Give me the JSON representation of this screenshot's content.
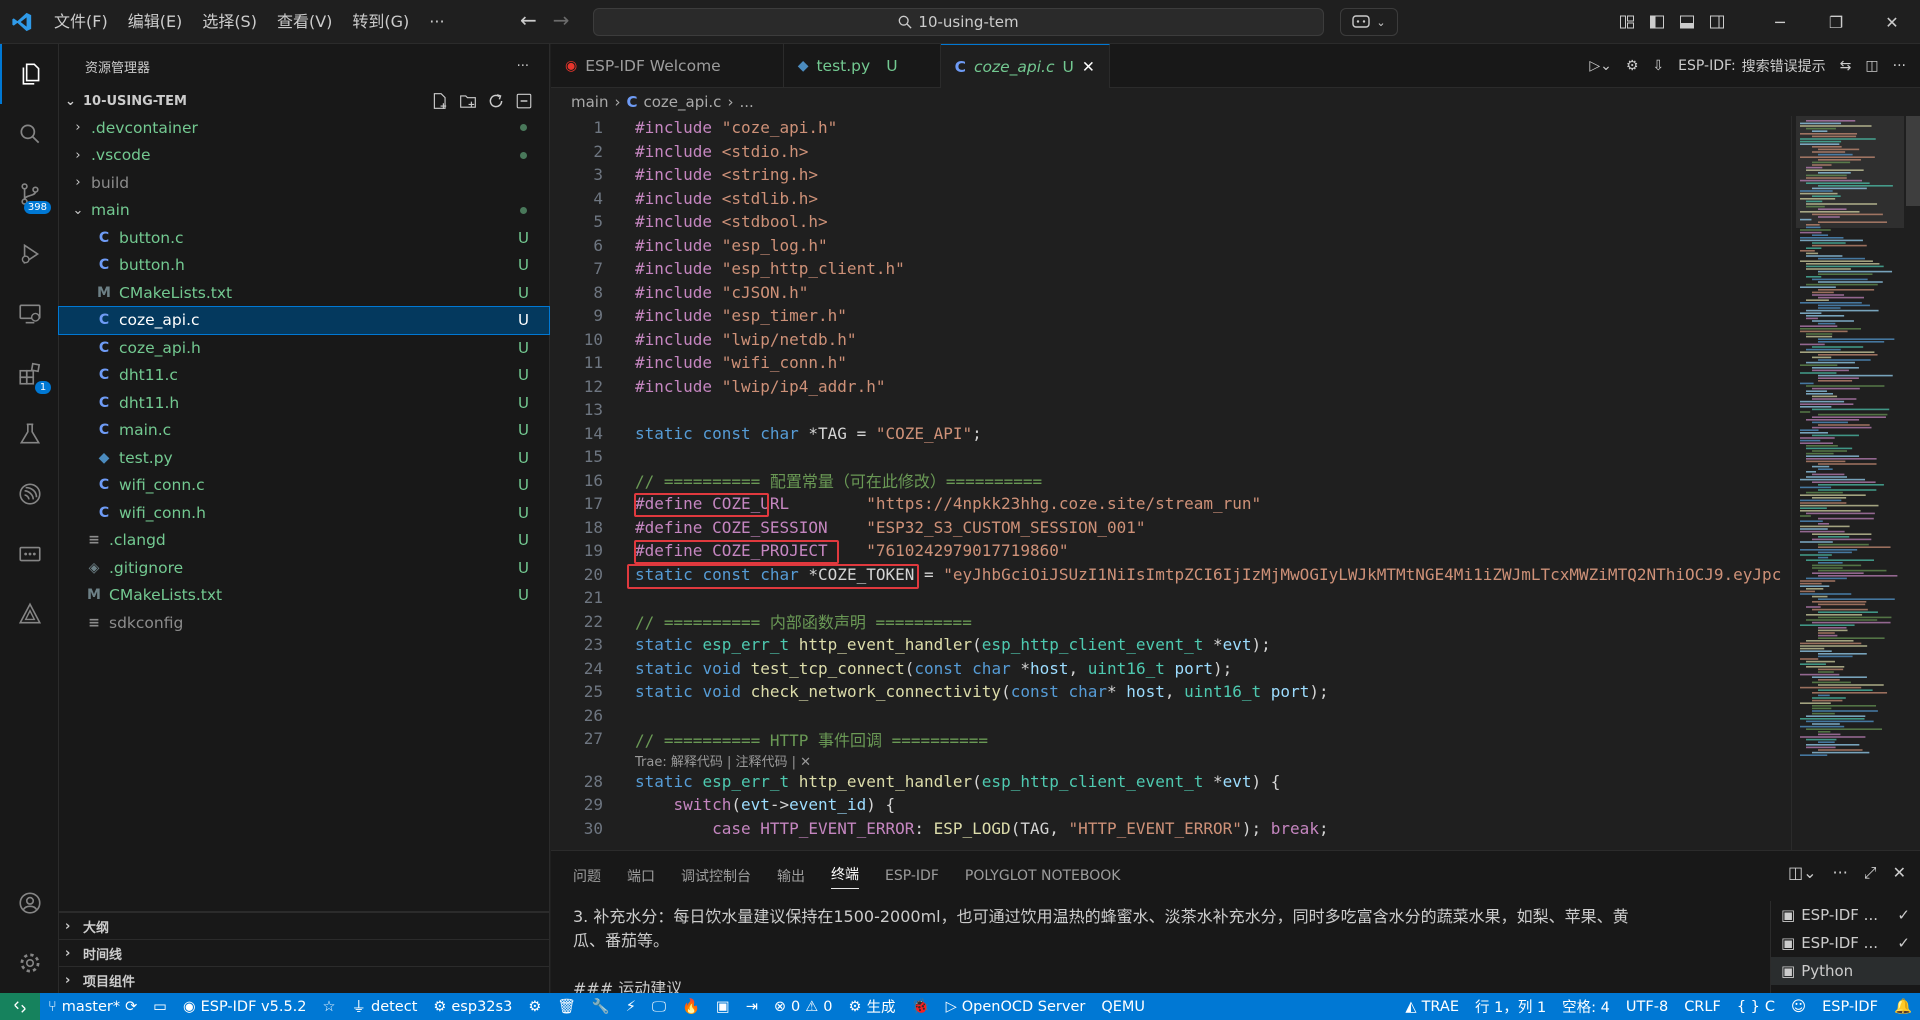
{
  "menu": [
    "文件(F)",
    "编辑(E)",
    "选择(S)",
    "查看(V)",
    "转到(G)",
    "···"
  ],
  "search": {
    "text": "10-using-tem"
  },
  "activity": {
    "scm_badge": "398",
    "ext_badge": "1"
  },
  "sidebar": {
    "title": "资源管理器",
    "more": "···",
    "root": "10-USING-TEM",
    "items": [
      {
        "name": ".devcontainer",
        "type": "folder-closed",
        "depth": 1,
        "status": "dot",
        "style": "git"
      },
      {
        "name": ".vscode",
        "type": "folder-closed",
        "depth": 1,
        "status": "dot",
        "style": "git"
      },
      {
        "name": "build",
        "type": "folder-closed",
        "depth": 1,
        "status": "",
        "style": "muted"
      },
      {
        "name": "main",
        "type": "folder-open",
        "depth": 1,
        "status": "dot",
        "style": "git"
      },
      {
        "name": "button.c",
        "type": "c",
        "depth": 2,
        "status": "U",
        "style": "git"
      },
      {
        "name": "button.h",
        "type": "c",
        "depth": 2,
        "status": "U",
        "style": "git"
      },
      {
        "name": "CMakeLists.txt",
        "type": "m",
        "depth": 2,
        "status": "U",
        "style": "git"
      },
      {
        "name": "coze_api.c",
        "type": "c",
        "depth": 2,
        "status": "U",
        "style": "selected"
      },
      {
        "name": "coze_api.h",
        "type": "c",
        "depth": 2,
        "status": "U",
        "style": "git"
      },
      {
        "name": "dht11.c",
        "type": "c",
        "depth": 2,
        "status": "U",
        "style": "git"
      },
      {
        "name": "dht11.h",
        "type": "c",
        "depth": 2,
        "status": "U",
        "style": "git"
      },
      {
        "name": "main.c",
        "type": "c",
        "depth": 2,
        "status": "U",
        "style": "git"
      },
      {
        "name": "test.py",
        "type": "py",
        "depth": 2,
        "status": "U",
        "style": "git"
      },
      {
        "name": "wifi_conn.c",
        "type": "c",
        "depth": 2,
        "status": "U",
        "style": "git"
      },
      {
        "name": "wifi_conn.h",
        "type": "c",
        "depth": 2,
        "status": "U",
        "style": "git"
      },
      {
        "name": ".clangd",
        "type": "file",
        "depth": 1,
        "status": "U",
        "style": "git"
      },
      {
        "name": ".gitignore",
        "type": "git",
        "depth": 1,
        "status": "U",
        "style": "git"
      },
      {
        "name": "CMakeLists.txt",
        "type": "m",
        "depth": 1,
        "status": "U",
        "style": "git"
      },
      {
        "name": "sdkconfig",
        "type": "file",
        "depth": 1,
        "status": "",
        "style": "muted"
      }
    ],
    "bottom_sections": [
      "大纲",
      "时间线",
      "项目组件"
    ]
  },
  "tabs": [
    {
      "label": "ESP-IDF Welcome",
      "icon": "esp",
      "status": "",
      "active": false
    },
    {
      "label": "test.py",
      "icon": "py",
      "status": "U",
      "active": false
    },
    {
      "label": "coze_api.c",
      "icon": "c",
      "status": "U",
      "active": true
    }
  ],
  "tab_actions": {
    "esp_label": "ESP-IDF:",
    "esp_action": "搜索错误提示"
  },
  "breadcrumb": [
    "main",
    "coze_api.c",
    "..."
  ],
  "codelens": "Trae: 解释代码 | 注释代码 | ✕",
  "code_lines": [
    {
      "n": "1",
      "t": [
        [
          "inc_kw",
          "#include "
        ],
        [
          "inc",
          "\"coze_api.h\""
        ]
      ]
    },
    {
      "n": "2",
      "t": [
        [
          "inc_kw",
          "#include "
        ],
        [
          "inc",
          "<stdio.h>"
        ]
      ]
    },
    {
      "n": "3",
      "t": [
        [
          "inc_kw",
          "#include "
        ],
        [
          "inc",
          "<string.h>"
        ]
      ]
    },
    {
      "n": "4",
      "t": [
        [
          "inc_kw",
          "#include "
        ],
        [
          "inc",
          "<stdlib.h>"
        ]
      ]
    },
    {
      "n": "5",
      "t": [
        [
          "inc_kw",
          "#include "
        ],
        [
          "inc",
          "<stdbool.h>"
        ]
      ]
    },
    {
      "n": "6",
      "t": [
        [
          "inc_kw",
          "#include "
        ],
        [
          "inc",
          "\"esp_log.h\""
        ]
      ]
    },
    {
      "n": "7",
      "t": [
        [
          "inc_kw",
          "#include "
        ],
        [
          "inc",
          "\"esp_http_client.h\""
        ]
      ]
    },
    {
      "n": "8",
      "t": [
        [
          "inc_kw",
          "#include "
        ],
        [
          "inc",
          "\"cJSON.h\""
        ]
      ]
    },
    {
      "n": "9",
      "t": [
        [
          "inc_kw",
          "#include "
        ],
        [
          "inc",
          "\"esp_timer.h\""
        ]
      ]
    },
    {
      "n": "10",
      "t": [
        [
          "inc_kw",
          "#include "
        ],
        [
          "inc",
          "\"lwip/netdb.h\""
        ]
      ]
    },
    {
      "n": "11",
      "t": [
        [
          "inc_kw",
          "#include "
        ],
        [
          "inc",
          "\"wifi_conn.h\""
        ]
      ]
    },
    {
      "n": "12",
      "t": [
        [
          "inc_kw",
          "#include "
        ],
        [
          "inc",
          "\"lwip/ip4_addr.h\""
        ]
      ]
    },
    {
      "n": "13",
      "t": []
    },
    {
      "n": "14",
      "t": [
        [
          "kw",
          "static "
        ],
        [
          "kw",
          "const "
        ],
        [
          "kw",
          "char "
        ],
        [
          "plain",
          "*TAG = "
        ],
        [
          "str",
          "\"COZE_API\""
        ],
        [
          "plain",
          ";"
        ]
      ]
    },
    {
      "n": "15",
      "t": []
    },
    {
      "n": "16",
      "t": [
        [
          "cm",
          "// ========== 配置常量（可在此修改）=========="
        ]
      ]
    },
    {
      "n": "17",
      "t": [
        [
          "pp",
          "#define "
        ],
        [
          "mac",
          "COZE_URL"
        ],
        [
          "plain",
          "        "
        ],
        [
          "str",
          "\"https://4npkk23hhg.coze.site/stream_run\""
        ]
      ]
    },
    {
      "n": "18",
      "t": [
        [
          "pp",
          "#define "
        ],
        [
          "mac",
          "COZE_SESSION"
        ],
        [
          "plain",
          "    "
        ],
        [
          "str",
          "\"ESP32_S3_CUSTOM_SESSION_001\""
        ]
      ]
    },
    {
      "n": "19",
      "t": [
        [
          "pp",
          "#define "
        ],
        [
          "mac",
          "COZE_PROJECT"
        ],
        [
          "plain",
          "    "
        ],
        [
          "str",
          "\"7610242979017719860\""
        ]
      ]
    },
    {
      "n": "20",
      "t": [
        [
          "kw",
          "static "
        ],
        [
          "kw",
          "const "
        ],
        [
          "kw",
          "char "
        ],
        [
          "plain",
          "*COZE_TOKEN = "
        ],
        [
          "str",
          "\"eyJhbGciOiJSUzI1NiIsImtpZCI6IjIzMjMwOGIyLWJkMTMtNGE4Mi1iZWJmLTcxMWZiMTQ2NThiOCJ9.eyJpc"
        ]
      ]
    },
    {
      "n": "21",
      "t": []
    },
    {
      "n": "22",
      "t": [
        [
          "cm",
          "// ========== 内部函数声明 =========="
        ]
      ]
    },
    {
      "n": "23",
      "t": [
        [
          "kw",
          "static "
        ],
        [
          "ty",
          "esp_err_t "
        ],
        [
          "fn",
          "http_event_handler"
        ],
        [
          "plain",
          "("
        ],
        [
          "ty",
          "esp_http_client_event_t "
        ],
        [
          "plain",
          "*"
        ],
        [
          "var",
          "evt"
        ],
        [
          "plain",
          ");"
        ]
      ]
    },
    {
      "n": "24",
      "t": [
        [
          "kw",
          "static "
        ],
        [
          "kw",
          "void "
        ],
        [
          "fn",
          "test_tcp_connect"
        ],
        [
          "plain",
          "("
        ],
        [
          "kw",
          "const "
        ],
        [
          "kw",
          "char "
        ],
        [
          "plain",
          "*"
        ],
        [
          "var",
          "host"
        ],
        [
          "plain",
          ", "
        ],
        [
          "ty",
          "uint16_t "
        ],
        [
          "var",
          "port"
        ],
        [
          "plain",
          ");"
        ]
      ]
    },
    {
      "n": "25",
      "t": [
        [
          "kw",
          "static "
        ],
        [
          "kw",
          "void "
        ],
        [
          "fn",
          "check_network_connectivity"
        ],
        [
          "plain",
          "("
        ],
        [
          "kw",
          "const "
        ],
        [
          "kw",
          "char"
        ],
        [
          "plain",
          "* "
        ],
        [
          "var",
          "host"
        ],
        [
          "plain",
          ", "
        ],
        [
          "ty",
          "uint16_t "
        ],
        [
          "var",
          "port"
        ],
        [
          "plain",
          ");"
        ]
      ]
    },
    {
      "n": "26",
      "t": []
    },
    {
      "n": "27",
      "t": [
        [
          "cm",
          "// ========== HTTP 事件回调 =========="
        ]
      ]
    },
    {
      "n": "28",
      "t": [
        [
          "kw",
          "static "
        ],
        [
          "ty",
          "esp_err_t "
        ],
        [
          "fn",
          "http_event_handler"
        ],
        [
          "plain",
          "("
        ],
        [
          "ty",
          "esp_http_client_event_t "
        ],
        [
          "plain",
          "*"
        ],
        [
          "var",
          "evt"
        ],
        [
          "plain",
          ") {"
        ]
      ]
    },
    {
      "n": "29",
      "t": [
        [
          "plain",
          "    "
        ],
        [
          "ctl",
          "switch"
        ],
        [
          "plain",
          "("
        ],
        [
          "var",
          "evt"
        ],
        [
          "plain",
          "->"
        ],
        [
          "var",
          "event_id"
        ],
        [
          "plain",
          ") {"
        ]
      ]
    },
    {
      "n": "30",
      "t": [
        [
          "plain",
          "        "
        ],
        [
          "ctl",
          "case "
        ],
        [
          "mac",
          "HTTP_EVENT_ERROR"
        ],
        [
          "plain",
          ": "
        ],
        [
          "fn",
          "ESP_LOGD"
        ],
        [
          "plain",
          "(TAG, "
        ],
        [
          "str",
          "\"HTTP_EVENT_ERROR\""
        ],
        [
          "plain",
          "); "
        ],
        [
          "ctl",
          "break"
        ],
        [
          "plain",
          ";"
        ]
      ]
    }
  ],
  "panel": {
    "tabs": [
      "问题",
      "端口",
      "调试控制台",
      "输出",
      "终端",
      "ESP-IDF",
      "POLYGLOT NOTEBOOK"
    ],
    "active_tab": "终端",
    "terminal_lines": [
      "3. 补充水分：每日饮水量建议保持在1500-2000ml，也可通过饮用温热的蜂蜜水、淡茶水补充水分，同时多吃富含水分的蔬菜水果，如梨、苹果、黄",
      "瓜、番茄等。",
      "",
      "### 运动建议"
    ],
    "terminals": [
      {
        "label": "ESP-IDF ...",
        "check": "✓"
      },
      {
        "label": "ESP-IDF ...",
        "check": "✓"
      },
      {
        "label": "Python",
        "check": ""
      }
    ]
  },
  "statusbar": {
    "branch": "master*",
    "idf_version": "ESP-IDF v5.5.2",
    "detect": "detect",
    "target": "esp32s3",
    "errors": "0",
    "warnings": "0",
    "build": "生成",
    "openocd": "OpenOCD Server",
    "qemu": "QEMU",
    "trae": "TRAE",
    "position": "行 1，列 1",
    "spaces": "空格: 4",
    "encoding": "UTF-8",
    "eol": "CRLF",
    "language": "C",
    "esp_idf": "ESP-IDF"
  },
  "colors": {
    "accent": "#0078d4",
    "highlight_box": "#e0393e",
    "git_untracked": "#73c991"
  }
}
